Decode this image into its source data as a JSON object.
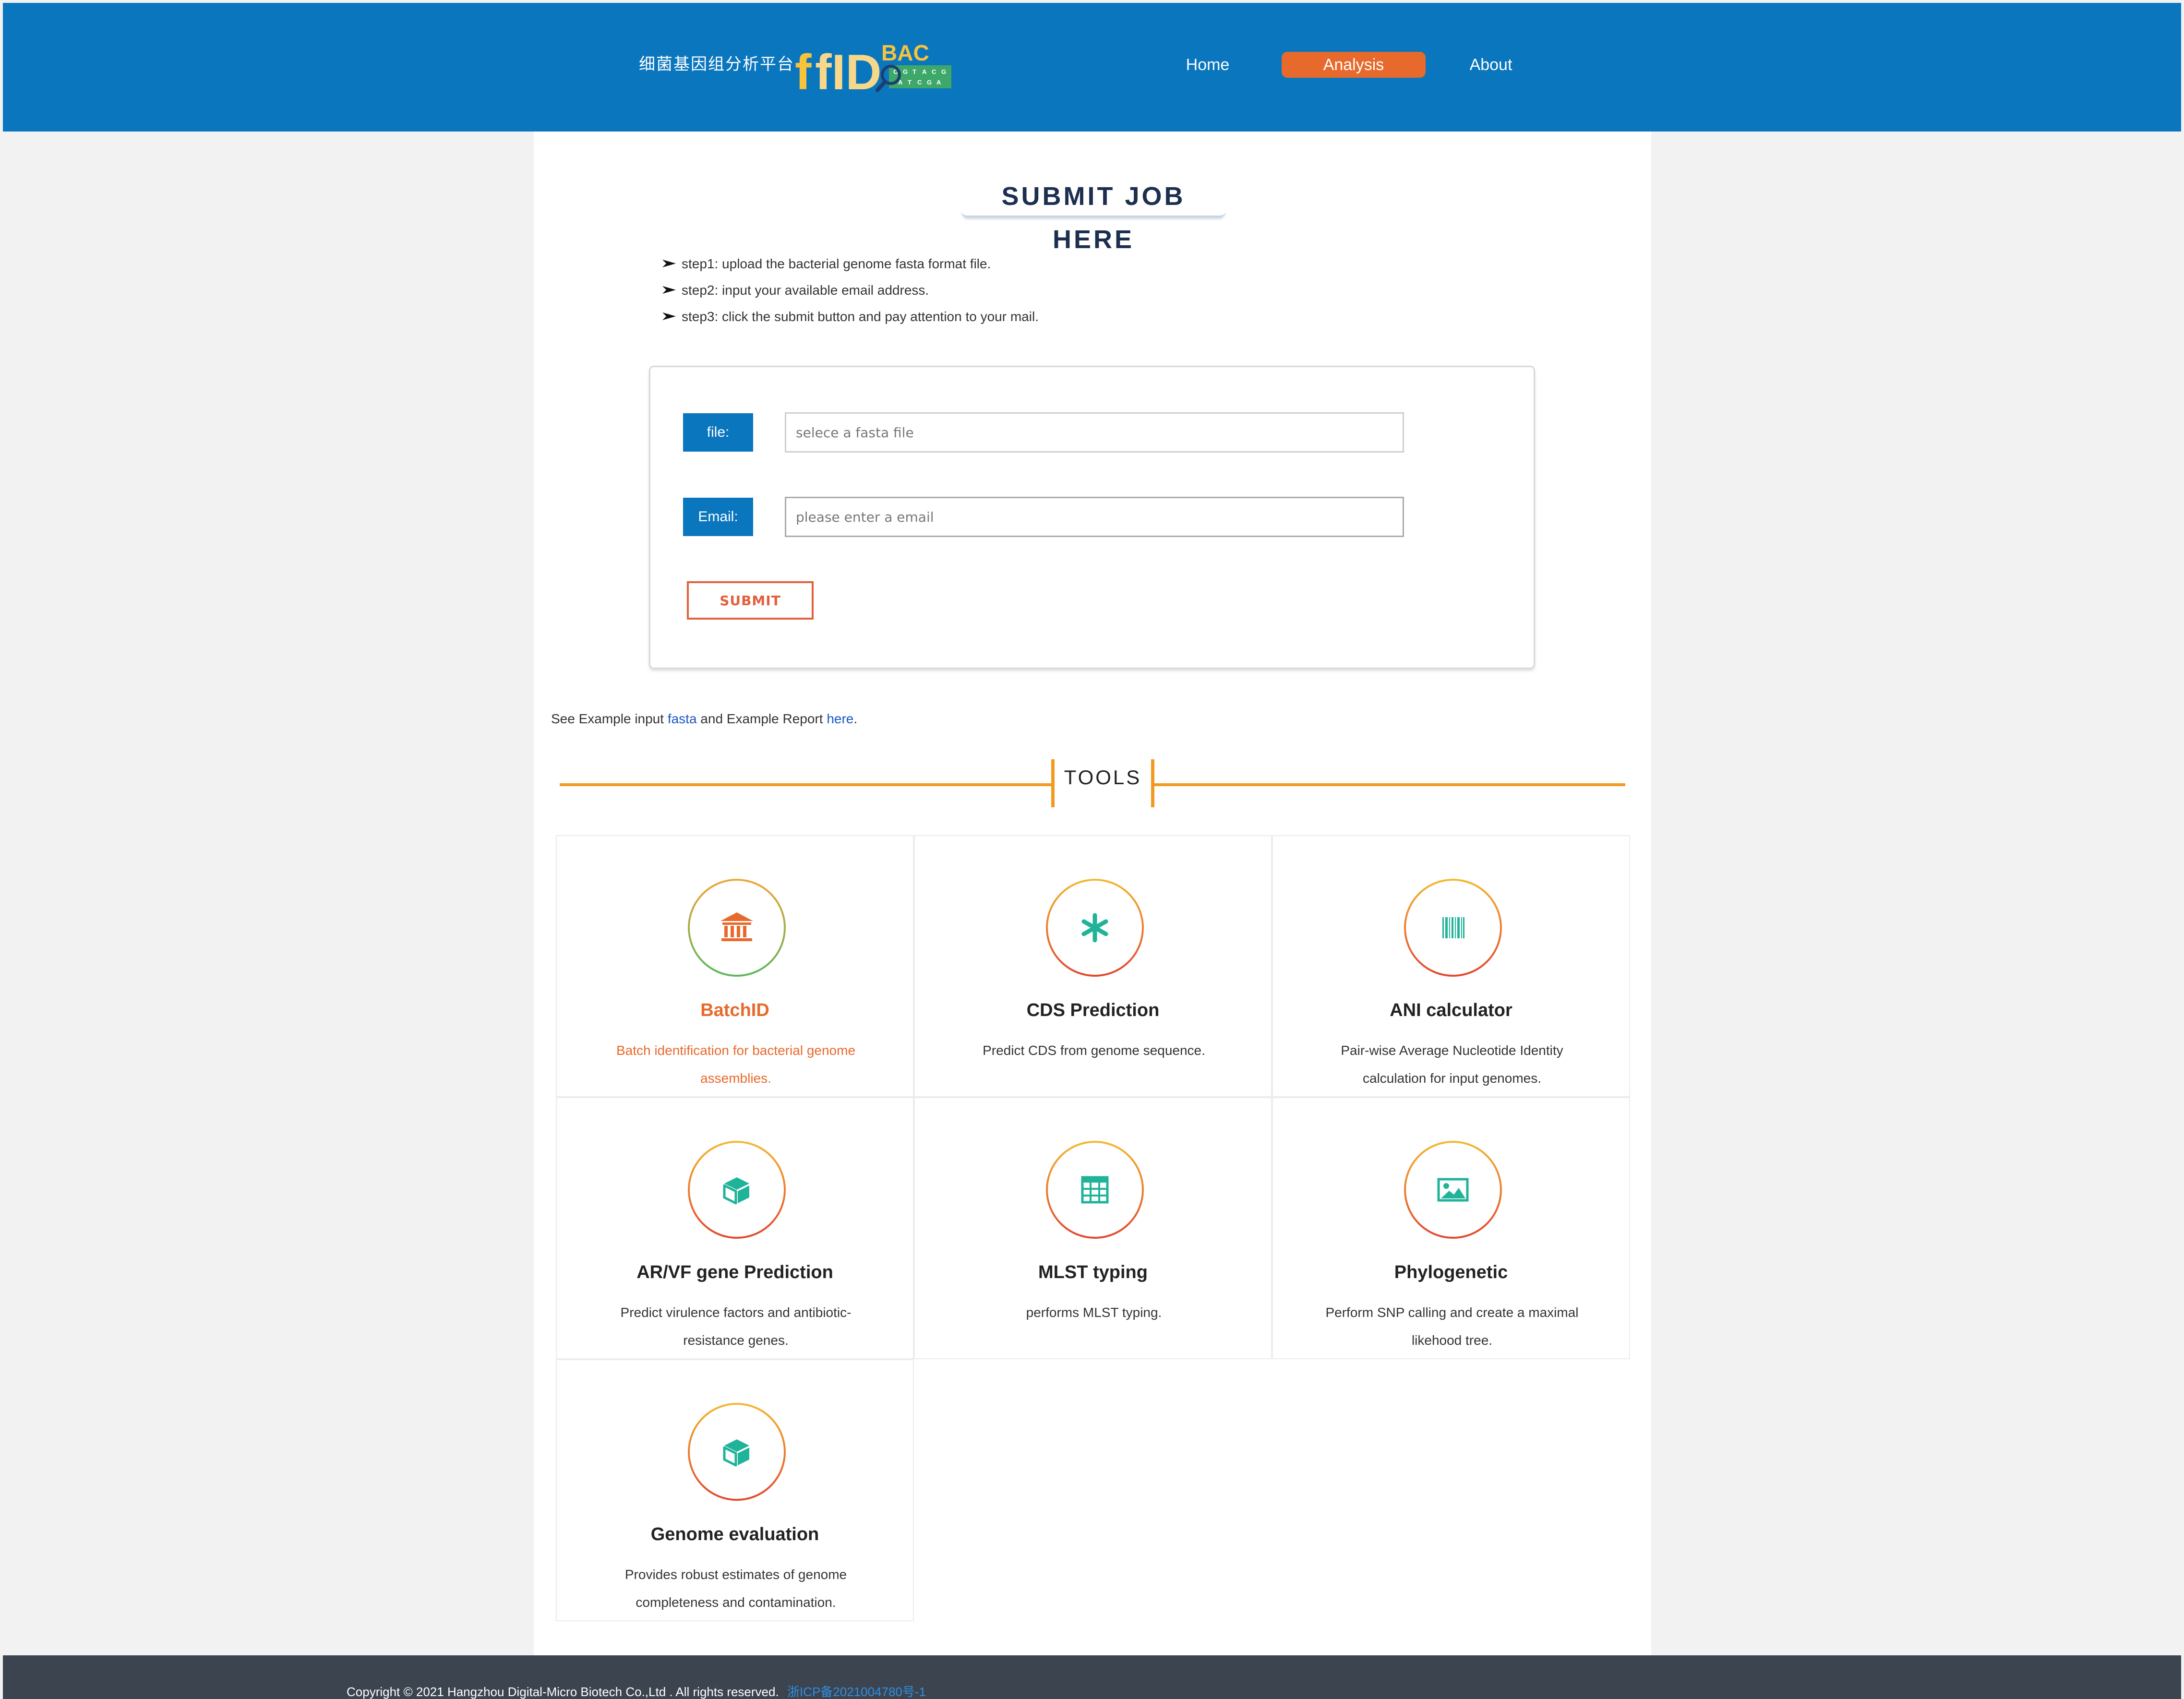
{
  "header": {
    "brand_cn": "细菌基因组分析平台",
    "logo": {
      "main": "fID",
      "sup": "BAC"
    },
    "nav": {
      "home": "Home",
      "analysis": "Analysis",
      "about": "About"
    },
    "colors": {
      "bar": "#0a76bd",
      "active": "#e8692c"
    }
  },
  "submit": {
    "title": "SUBMIT JOB HERE",
    "steps": [
      "step1: upload the bacterial genome fasta format file.",
      "step2: input your available email address.",
      "step3: click the submit button and pay attention to your mail."
    ],
    "file_label": "file:",
    "file_placeholder": "selece a fasta file",
    "email_label": "Email:",
    "email_placeholder": "please enter a email",
    "submit_label": "SUBMIT"
  },
  "example": {
    "prefix": "See Example input ",
    "fasta_link": "fasta",
    "middle": " and Example Report ",
    "here_link": "here",
    "suffix": "."
  },
  "tools": {
    "title": "TOOLS",
    "items": [
      {
        "name": "BatchID",
        "desc": "Batch identification for bacterial genome assemblies.",
        "icon": "bank-icon",
        "active": true
      },
      {
        "name": "CDS Prediction",
        "desc": "Predict CDS from genome sequence.",
        "icon": "asterisk-icon",
        "active": false
      },
      {
        "name": "ANI calculator",
        "desc": "Pair-wise Average Nucleotide Identity calculation for input genomes.",
        "icon": "barcode-icon",
        "active": false
      },
      {
        "name": "AR/VF gene Prediction",
        "desc": "Predict virulence factors and antibiotic-resistance genes.",
        "icon": "cube-icon",
        "active": false
      },
      {
        "name": "MLST typing",
        "desc": "performs MLST typing.",
        "icon": "table-icon",
        "active": false
      },
      {
        "name": "Phylogenetic",
        "desc": "Perform SNP calling and create a maximal likehood tree.",
        "icon": "picture-icon",
        "active": false
      },
      {
        "name": "Genome evaluation",
        "desc": "Provides robust estimates of genome completeness and contamination.",
        "icon": "cube-icon",
        "active": false
      }
    ]
  },
  "footer": {
    "copyright": "Copyright © 2021 Hangzhou Digital-Micro Biotech Co.,Ltd . All rights reserved.",
    "icp": "浙ICP备2021004780号-1"
  }
}
